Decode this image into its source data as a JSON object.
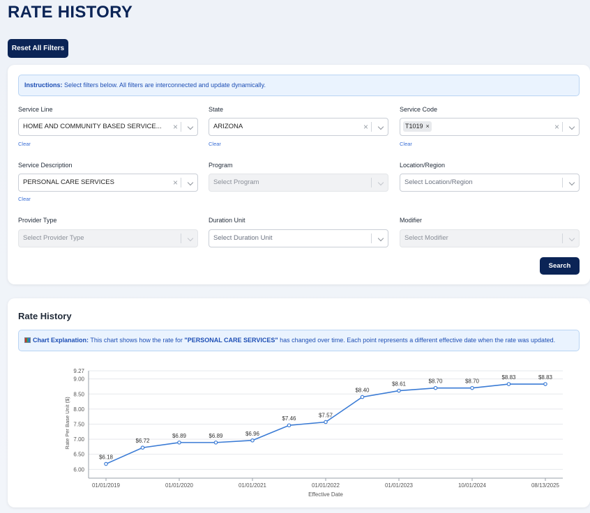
{
  "page": {
    "title": "RATE HISTORY",
    "reset_label": "Reset All Filters"
  },
  "instructions": {
    "bold": "Instructions:",
    "text": " Select filters below. All filters are interconnected and update dynamically."
  },
  "filters": {
    "service_line": {
      "label": "Service Line",
      "value": "HOME AND COMMUNITY BASED SERVICE...",
      "clear": "Clear"
    },
    "state": {
      "label": "State",
      "value": "ARIZONA",
      "clear": "Clear"
    },
    "service_code": {
      "label": "Service Code",
      "tag": "T1019",
      "clear": "Clear"
    },
    "service_description": {
      "label": "Service Description",
      "value": "PERSONAL CARE SERVICES",
      "clear": "Clear"
    },
    "program": {
      "label": "Program",
      "placeholder": "Select Program"
    },
    "location_region": {
      "label": "Location/Region",
      "placeholder": "Select Location/Region"
    },
    "provider_type": {
      "label": "Provider Type",
      "placeholder": "Select Provider Type"
    },
    "duration_unit": {
      "label": "Duration Unit",
      "placeholder": "Select Duration Unit"
    },
    "modifier": {
      "label": "Modifier",
      "placeholder": "Select Modifier"
    },
    "search_label": "Search"
  },
  "chart_section": {
    "title": "Rate History",
    "explain_bold": "Chart Explanation:",
    "explain_text_1": " This chart shows how the rate for ",
    "explain_highlight": "\"PERSONAL CARE SERVICES\"",
    "explain_text_2": " has changed over time. Each point represents a different effective date when the rate was updated."
  },
  "colors": {
    "primary": "#0b2456",
    "line": "#3a7bd5",
    "info_bg": "#eaf3fe"
  },
  "chart_data": {
    "type": "line",
    "xlabel": "Effective Date",
    "ylabel": "Rate Per Base Unit ($)",
    "ylim": [
      5.8,
      9.27
    ],
    "yticks": [
      "6.00",
      "6.50",
      "7.00",
      "7.50",
      "8.00",
      "8.50",
      "9.00",
      "9.27"
    ],
    "ytick_values": [
      6.0,
      6.5,
      7.0,
      7.5,
      8.0,
      8.5,
      9.0,
      9.27
    ],
    "xtick_labels": [
      "01/01/2019",
      "01/01/2020",
      "01/01/2021",
      "01/01/2022",
      "01/01/2023",
      "10/01/2024",
      "08/13/2025"
    ],
    "xtick_indices": [
      0,
      2,
      4,
      6,
      8,
      10,
      12
    ],
    "grid": true,
    "values": [
      6.18,
      6.72,
      6.89,
      6.89,
      6.96,
      7.46,
      7.57,
      8.4,
      8.61,
      8.7,
      8.7,
      8.83,
      8.83
    ],
    "data_labels": [
      "$6.18",
      "$6.72",
      "$6.89",
      "$6.89",
      "$6.96",
      "$7.46",
      "$7.57",
      "$8.40",
      "$8.61",
      "$8.70",
      "$8.70",
      "$8.83",
      "$8.83"
    ]
  }
}
